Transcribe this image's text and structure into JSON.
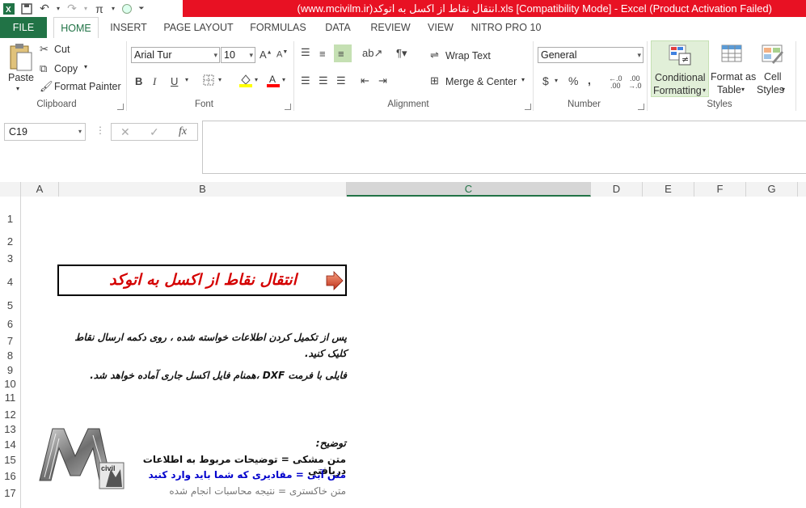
{
  "app": {
    "title": "(www.mcivilm.ir)انتقال نقاط از اکسل به اتوکد.xls  [Compatibility Mode]  -  Excel (Product Activation Failed)"
  },
  "qat": {
    "pi_label": "π"
  },
  "tabs": [
    "FILE",
    "HOME",
    "INSERT",
    "PAGE LAYOUT",
    "FORMULAS",
    "DATA",
    "REVIEW",
    "VIEW",
    "NITRO PRO 10"
  ],
  "ribbon": {
    "clipboard": {
      "paste": "Paste",
      "cut": "Cut",
      "copy": "Copy",
      "format_painter": "Format Painter",
      "label": "Clipboard"
    },
    "font": {
      "name": "Arial Tur",
      "size": "10",
      "bold": "B",
      "italic": "I",
      "underline": "U",
      "label": "Font"
    },
    "alignment": {
      "wrap_text": "Wrap Text",
      "merge_center": "Merge & Center",
      "label": "Alignment"
    },
    "number": {
      "format": "General",
      "currency": "$",
      "percent": "%",
      "comma": ",",
      "label": "Number"
    },
    "styles": {
      "conditional_1": "Conditional",
      "conditional_2": "Formatting",
      "format_table_1": "Format as",
      "format_table_2": "Table",
      "cell_styles_1": "Cell",
      "cell_styles_2": "Styles",
      "label": "Styles"
    }
  },
  "formula_bar": {
    "name_box": "C19",
    "fx": "fx",
    "value": ""
  },
  "grid": {
    "columns": [
      "A",
      "B",
      "C",
      "D",
      "E",
      "F",
      "G"
    ],
    "rows": [
      "1",
      "2",
      "3",
      "4",
      "5",
      "6",
      "7",
      "8",
      "9",
      "10",
      "11",
      "12",
      "13",
      "14",
      "15",
      "16",
      "17"
    ],
    "cells": {
      "title": "انتقال نقاط از اکسل به اتوکد",
      "instruction_1": "پس از تکمیل کردن اطلاعات خواسته شده ، روی دکمه ارسال نقاط",
      "instruction_2": "کلیک کنید.",
      "instruction_3": "فایلی با فرمت DXF ،همنام فایل اکسل جاری آماده خواهد شد.",
      "notes_title": "توضیح:",
      "note_black": "متن مشکی = توضیحات مربوط به اطلاعات دریافتی",
      "note_blue": "متن آبی = مقادیری که شما باید وارد کنید",
      "note_gray": "متن خاکستری = نتیجه محاسبات انجام شده",
      "logo_text": "civil"
    }
  },
  "colors": {
    "excel_green": "#217346",
    "title_red": "#e81123",
    "title_text": "#d40000",
    "blue_text": "#0000cc",
    "gray_text": "#777777"
  }
}
